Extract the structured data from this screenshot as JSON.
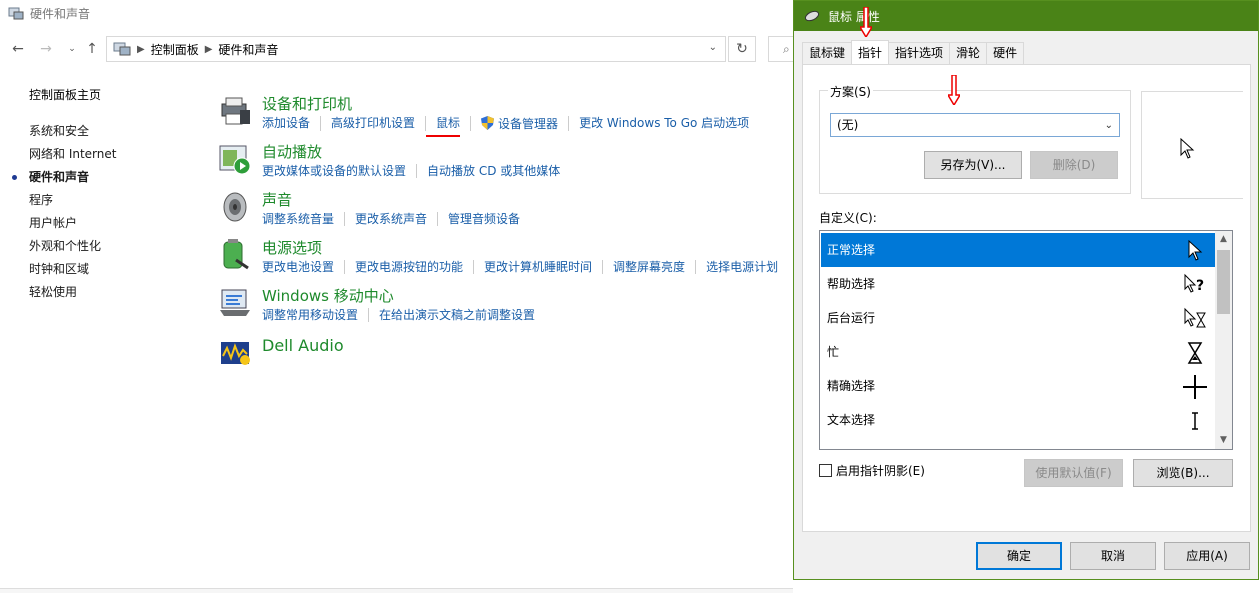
{
  "control_panel": {
    "window_title": "硬件和声音",
    "breadcrumb": [
      "控制面板",
      "硬件和声音"
    ],
    "left_nav": {
      "home": "控制面板主页",
      "items": [
        {
          "label": "系统和安全",
          "active": false
        },
        {
          "label": "网络和 Internet",
          "active": false
        },
        {
          "label": "硬件和声音",
          "active": true
        },
        {
          "label": "程序",
          "active": false
        },
        {
          "label": "用户帐户",
          "active": false
        },
        {
          "label": "外观和个性化",
          "active": false
        },
        {
          "label": "时钟和区域",
          "active": false
        },
        {
          "label": "轻松使用",
          "active": false
        }
      ]
    },
    "categories": [
      {
        "title": "设备和打印机",
        "icon": "printer-icon",
        "links": [
          "添加设备",
          "高级打印机设置",
          "鼠标",
          "设备管理器",
          "更改 Windows To Go 启动选项"
        ]
      },
      {
        "title": "自动播放",
        "icon": "autoplay-icon",
        "links": [
          "更改媒体或设备的默认设置",
          "自动播放 CD 或其他媒体"
        ]
      },
      {
        "title": "声音",
        "icon": "speaker-icon",
        "links": [
          "调整系统音量",
          "更改系统声音",
          "管理音频设备"
        ]
      },
      {
        "title": "电源选项",
        "icon": "battery-icon",
        "links": [
          "更改电池设置",
          "更改电源按钮的功能",
          "更改计算机睡眠时间",
          "调整屏幕亮度",
          "选择电源计划"
        ]
      },
      {
        "title": "Windows 移动中心",
        "icon": "mobility-center-icon",
        "links": [
          "调整常用移动设置",
          "在给出演示文稿之前调整设置"
        ]
      },
      {
        "title": "Dell Audio",
        "icon": "dell-audio-icon",
        "links": []
      }
    ]
  },
  "mouse_dialog": {
    "title": "鼠标 属性",
    "tabs": [
      {
        "label": "鼠标键",
        "selected": false
      },
      {
        "label": "指针",
        "selected": true
      },
      {
        "label": "指针选项",
        "selected": false
      },
      {
        "label": "滑轮",
        "selected": false
      },
      {
        "label": "硬件",
        "selected": false
      }
    ],
    "scheme_label": "方案(S)",
    "scheme_value": "(无)",
    "save_as_label": "另存为(V)...",
    "delete_label": "删除(D)",
    "customize_label": "自定义(C):",
    "cursors": [
      {
        "label": "正常选择",
        "icon": "arrow-cursor-icon",
        "selected": true
      },
      {
        "label": "帮助选择",
        "icon": "help-cursor-icon",
        "selected": false
      },
      {
        "label": "后台运行",
        "icon": "working-cursor-icon",
        "selected": false
      },
      {
        "label": "忙",
        "icon": "busy-hourglass-icon",
        "selected": false
      },
      {
        "label": "精确选择",
        "icon": "crosshair-cursor-icon",
        "selected": false
      },
      {
        "label": "文本选择",
        "icon": "text-beam-cursor-icon",
        "selected": false
      }
    ],
    "enable_shadow_label": "启用指针阴影(E)",
    "enable_shadow_checked": false,
    "use_default_label": "使用默认值(F)",
    "browse_label": "浏览(B)...",
    "ok_label": "确定",
    "cancel_label": "取消",
    "apply_label": "应用(A)"
  },
  "colors": {
    "dialog_title_bar": "#4a8317",
    "category_title": "#1e8a2c",
    "link": "#1a5ea8",
    "selection": "#0078d7",
    "annotation_red": "#e00000"
  }
}
